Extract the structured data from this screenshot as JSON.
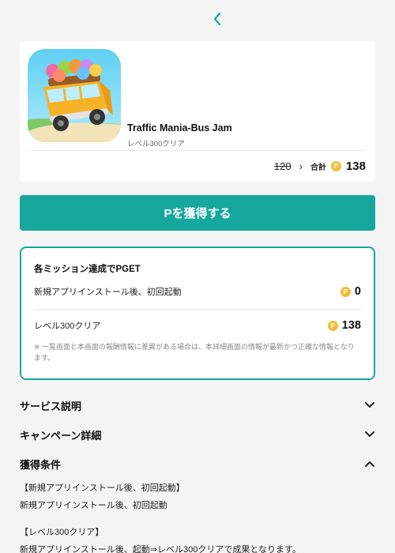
{
  "header": {
    "back_icon": "chevron-left-icon"
  },
  "app": {
    "title": "Traffic Mania-Bus Jam",
    "subtitle": "レベル300クリア",
    "icon": "bus-game-app-icon"
  },
  "pricing": {
    "old": "120",
    "arrow": "›",
    "total_label": "合計",
    "coin_symbol": "P",
    "total": "138"
  },
  "cta": {
    "label": "Pを獲得する"
  },
  "missions": {
    "title": "各ミッション達成でPGET",
    "items": [
      {
        "label": "新規アプリインストール後、初回起動",
        "points": "0"
      },
      {
        "label": "レベル300クリア",
        "points": "138"
      }
    ],
    "note": "※ 一覧画面と本画面の報酬情報に差異がある場合は、本詳細画面の情報が最新かつ正確な情報となります。"
  },
  "sections": [
    {
      "title": "サービス説明",
      "state": "collapsed",
      "icon": "chevron-down-icon"
    },
    {
      "title": "キャンペーン詳細",
      "state": "collapsed",
      "icon": "chevron-down-icon"
    },
    {
      "title": "獲得条件",
      "state": "expanded",
      "icon": "chevron-up-icon"
    }
  ],
  "conditions": {
    "heading1": "【新規アプリインストール後、初回起動】",
    "text1": "新規アプリインストール後、初回起動",
    "heading2": "【レベル300クリア】",
    "text2": "新規アプリインストール後、起動⇒レベル300クリアで成果となります。"
  },
  "colors": {
    "accent": "#16a79e",
    "coin": "#f3bd38",
    "background": "#f4f4f4"
  }
}
